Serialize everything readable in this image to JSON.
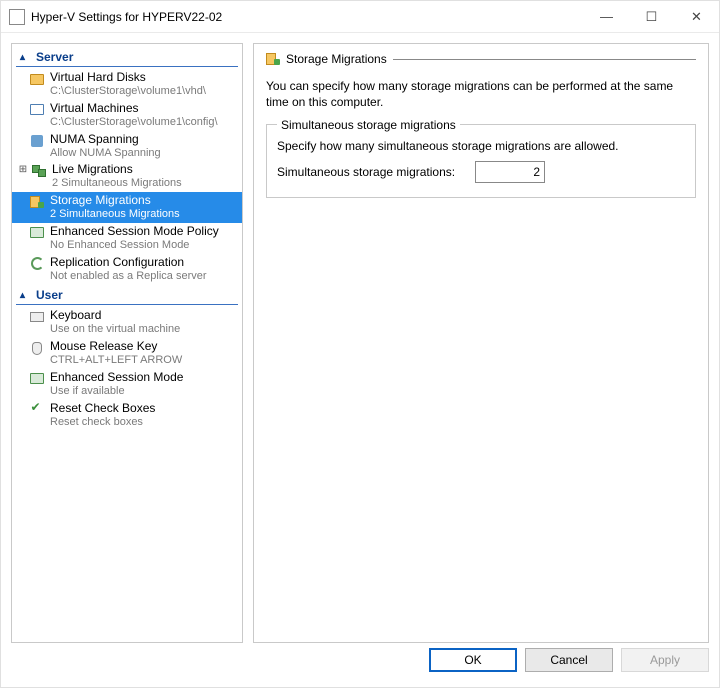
{
  "window": {
    "title": "Hyper-V Settings for HYPERV22-02",
    "controls": {
      "minimize": "—",
      "maximize": "☐",
      "close": "✕"
    }
  },
  "nav": {
    "sections": {
      "server": {
        "label": "Server",
        "items": [
          {
            "id": "vhd",
            "label": "Virtual Hard Disks",
            "sub": "C:\\ClusterStorage\\volume1\\vhd\\"
          },
          {
            "id": "vms",
            "label": "Virtual Machines",
            "sub": "C:\\ClusterStorage\\volume1\\config\\"
          },
          {
            "id": "numa",
            "label": "NUMA Spanning",
            "sub": "Allow NUMA Spanning"
          },
          {
            "id": "livemig",
            "label": "Live Migrations",
            "sub": "2 Simultaneous Migrations",
            "expandable": true
          },
          {
            "id": "stormig",
            "label": "Storage Migrations",
            "sub": "2 Simultaneous Migrations",
            "selected": true
          },
          {
            "id": "esm",
            "label": "Enhanced Session Mode Policy",
            "sub": "No Enhanced Session Mode"
          },
          {
            "id": "repl",
            "label": "Replication Configuration",
            "sub": "Not enabled as a Replica server"
          }
        ]
      },
      "user": {
        "label": "User",
        "items": [
          {
            "id": "keyboard",
            "label": "Keyboard",
            "sub": "Use on the virtual machine"
          },
          {
            "id": "mouse",
            "label": "Mouse Release Key",
            "sub": "CTRL+ALT+LEFT ARROW"
          },
          {
            "id": "esmuser",
            "label": "Enhanced Session Mode",
            "sub": "Use if available"
          },
          {
            "id": "reset",
            "label": "Reset Check Boxes",
            "sub": "Reset check boxes"
          }
        ]
      }
    }
  },
  "panel": {
    "title": "Storage Migrations",
    "description": "You can specify how many storage migrations can be performed at the same time on this computer.",
    "group": {
      "legend": "Simultaneous storage migrations",
      "instruction": "Specify how many simultaneous storage migrations are allowed.",
      "field_label": "Simultaneous storage migrations:",
      "value": "2"
    }
  },
  "buttons": {
    "ok": "OK",
    "cancel": "Cancel",
    "apply": "Apply"
  }
}
